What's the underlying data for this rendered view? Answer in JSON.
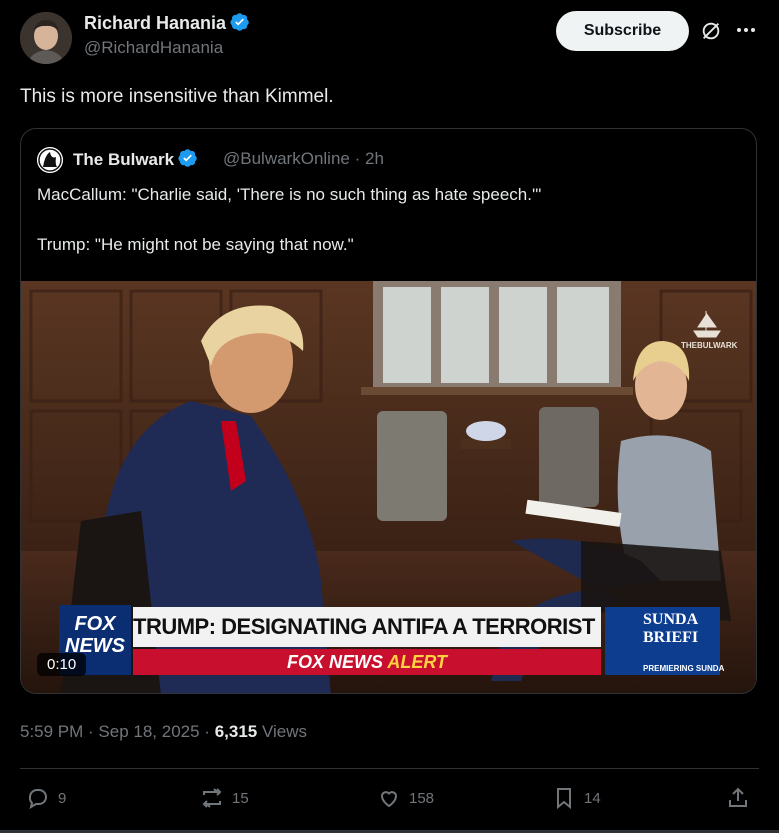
{
  "author": {
    "name": "Richard Hanania",
    "handle": "@RichardHanania",
    "verified": true
  },
  "header": {
    "subscribe_label": "Subscribe"
  },
  "tweet": {
    "text": "This is more insensitive than Kimmel."
  },
  "quote": {
    "name": "The Bulwark",
    "handle": "@BulwarkOnline",
    "age": "2h",
    "line1": "MacCallum: \"Charlie said, 'There is no such thing as hate speech.'\"",
    "line2": "Trump: \"He might not be saying that now.\""
  },
  "video": {
    "duration": "0:10",
    "watermark": "THEBULWARK",
    "chyron_main": "TRUMP: DESIGNATING ANTIFA A TERRORIST ORGANIZATION",
    "chyron_alert_prefix": "FOX NEWS",
    "chyron_alert_suffix": "ALERT",
    "network_logo": "FOX NEWS",
    "promo_title_1": "SUNDA",
    "promo_title_2": "BRIEFI",
    "promo_sub": "PREMIERING SUNDA"
  },
  "meta": {
    "time": "5:59 PM",
    "date": "Sep 18, 2025",
    "views_count": "6,315",
    "views_label": "Views"
  },
  "actions": {
    "replies": "9",
    "reposts": "15",
    "likes": "158",
    "bookmarks": "14"
  },
  "colors": {
    "background": "#000000",
    "text": "#e7e9ea",
    "secondary": "#71767b",
    "verified": "#1d9bf0",
    "border": "#2f3336"
  }
}
